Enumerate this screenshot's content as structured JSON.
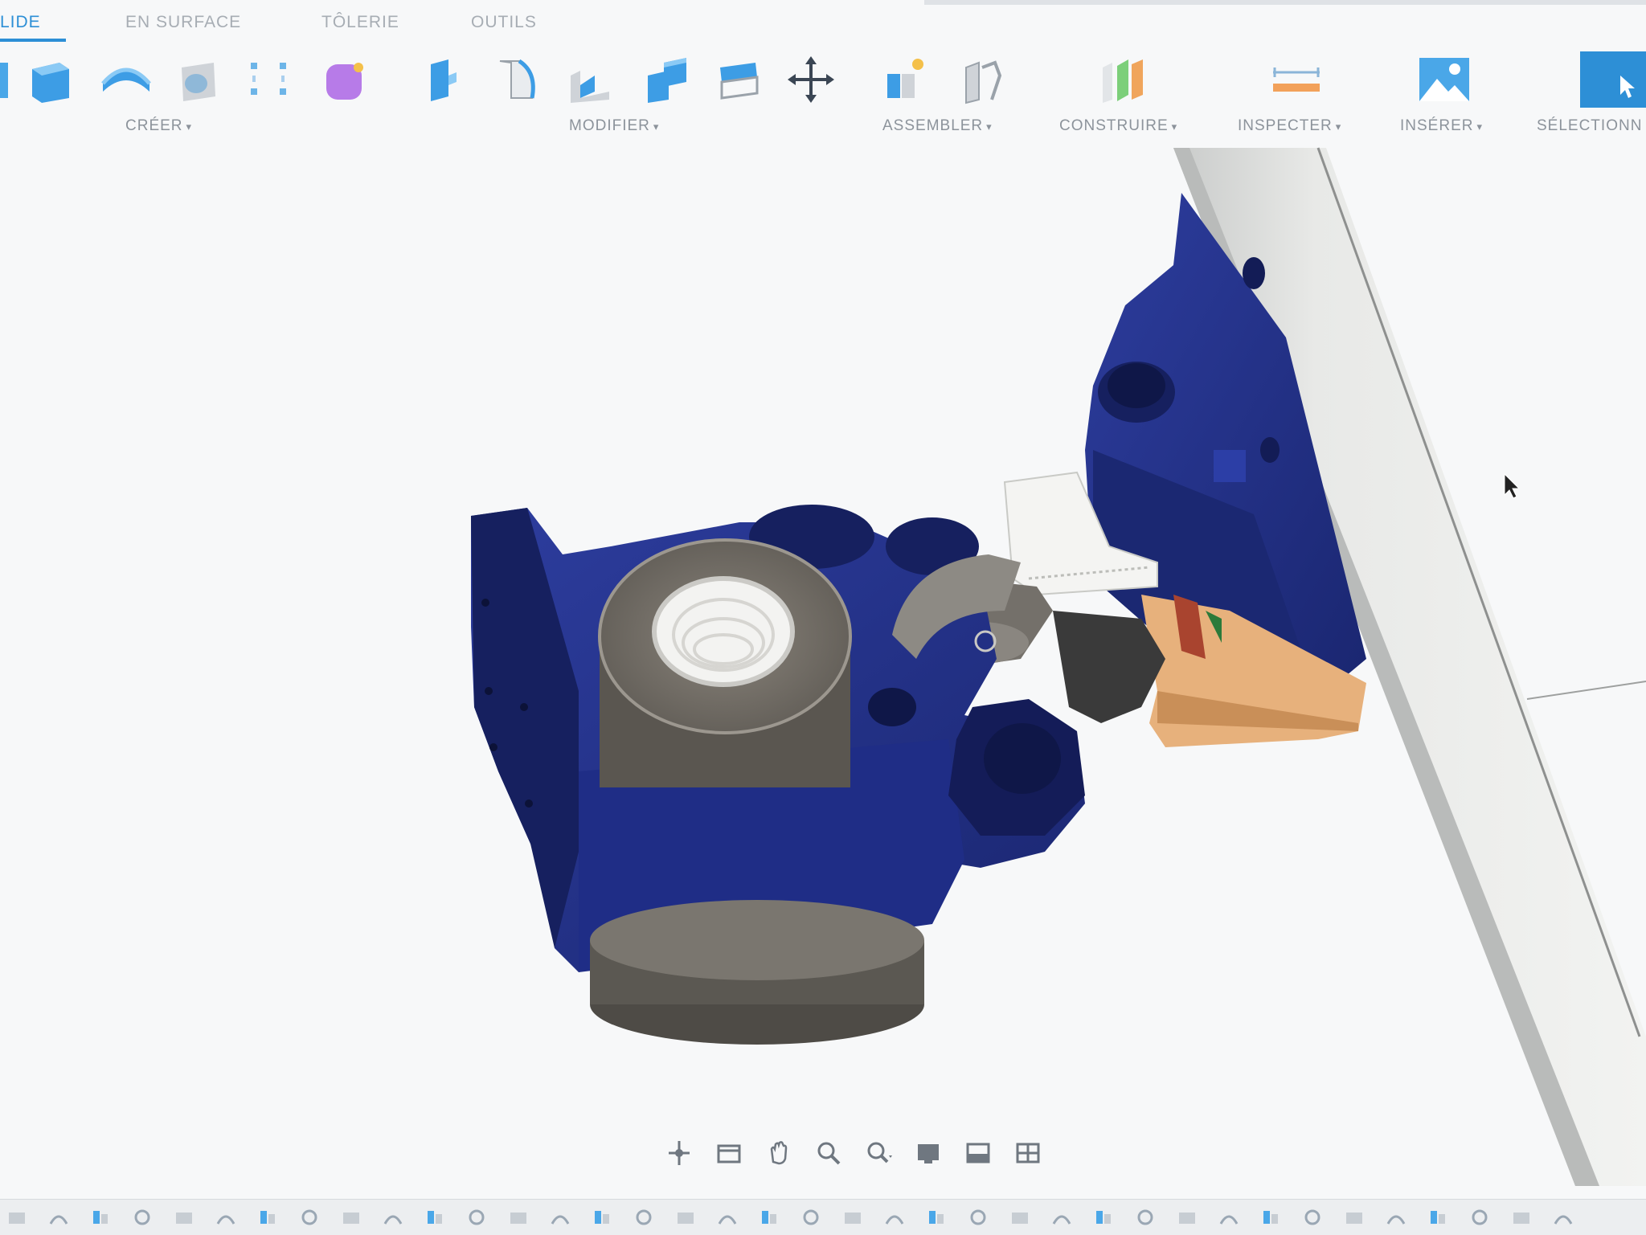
{
  "tabs": [
    {
      "label": "LIDE",
      "active": true
    },
    {
      "label": "EN SURFACE",
      "active": false
    },
    {
      "label": "TÔLERIE",
      "active": false
    },
    {
      "label": "OUTILS",
      "active": false
    }
  ],
  "toolbar_groups": {
    "creer": "CRÉER",
    "modifier": "MODIFIER",
    "assembler": "ASSEMBLER",
    "construire": "CONSTRUIRE",
    "inspecter": "INSPECTER",
    "inserer": "INSÉRER",
    "selectionner": "SÉLECTIONN"
  },
  "dropdown_caret": "▾",
  "colors": {
    "accent": "#2d8fd6",
    "part_blue": "#1f2f8a",
    "part_gray": "#6f6b64",
    "part_tan": "#e7b17c"
  },
  "icons": {
    "create": [
      "sketch-icon",
      "extrude-icon",
      "revolve-icon",
      "hole-icon",
      "pattern-icon",
      "form-icon"
    ],
    "modify": [
      "press-pull-icon",
      "fillet-icon",
      "chamfer-icon",
      "combine-icon",
      "shell-icon",
      "move-icon"
    ],
    "assemble": [
      "new-component-icon",
      "joint-icon"
    ],
    "construct": "construct-plane-icon",
    "inspect": "measure-icon",
    "insert": "insert-image-icon",
    "select": "select-icon"
  }
}
